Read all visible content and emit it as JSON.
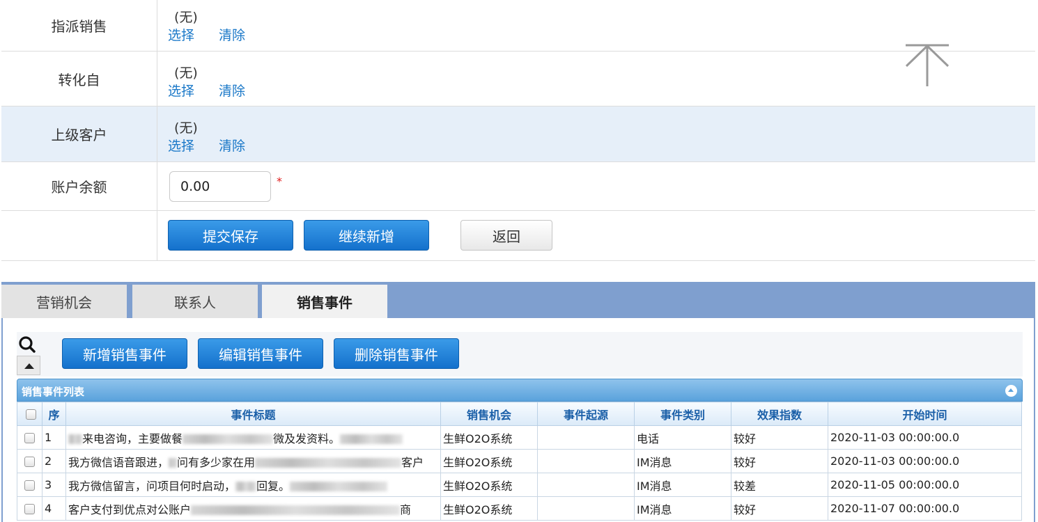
{
  "form": {
    "assigned_sales": {
      "label": "指派销售",
      "value": "(无)",
      "select": "选择",
      "clear": "清除"
    },
    "converted_from": {
      "label": "转化自",
      "value": "(无)",
      "select": "选择",
      "clear": "清除"
    },
    "parent_customer": {
      "label": "上级客户",
      "value": "(无)",
      "select": "选择",
      "clear": "清除"
    },
    "account_balance": {
      "label": "账户余额",
      "value": "0.00",
      "required_mark": "*"
    },
    "buttons": {
      "submit": "提交保存",
      "continue_add": "继续新增",
      "back": "返回"
    }
  },
  "tabs": [
    {
      "label": "营销机会",
      "active": false
    },
    {
      "label": "联系人",
      "active": false
    },
    {
      "label": "销售事件",
      "active": true
    }
  ],
  "toolbar": {
    "add": "新增销售事件",
    "edit": "编辑销售事件",
    "delete": "删除销售事件"
  },
  "grid": {
    "title": "销售事件列表",
    "columns": [
      "序",
      "事件标题",
      "销售机会",
      "事件起源",
      "事件类别",
      "效果指数",
      "开始时间"
    ],
    "rows": [
      {
        "index": "1",
        "title_a": "",
        "title_b": "来电咨询，主要做餐",
        "title_c": "",
        "title_d": "微及发资料。",
        "opportunity": "生鲜O2O系统",
        "origin": "",
        "category": "电话",
        "effect": "较好",
        "start": "2020-11-03 00:00:00.0"
      },
      {
        "index": "2",
        "title_a": "我方微信语音跟进，",
        "title_b": "问有多少家在用",
        "title_c": "",
        "title_d": "客户",
        "opportunity": "生鲜O2O系统",
        "origin": "",
        "category": "IM消息",
        "effect": "较好",
        "start": "2020-11-03 00:00:00.0"
      },
      {
        "index": "3",
        "title_a": "我方微信留言，问项目何时启动，",
        "title_b": "",
        "title_c": "回复。",
        "title_d": "",
        "opportunity": "生鲜O2O系统",
        "origin": "",
        "category": "IM消息",
        "effect": "较差",
        "start": "2020-11-05 00:00:00.0"
      },
      {
        "index": "4",
        "title_a": "客户支付到优点对公账户",
        "title_b": "",
        "title_c": "",
        "title_d": "商",
        "opportunity": "生鲜O2O系统",
        "origin": "",
        "category": "IM消息",
        "effect": "较好",
        "start": "2020-11-07 00:00:00.0"
      }
    ]
  }
}
